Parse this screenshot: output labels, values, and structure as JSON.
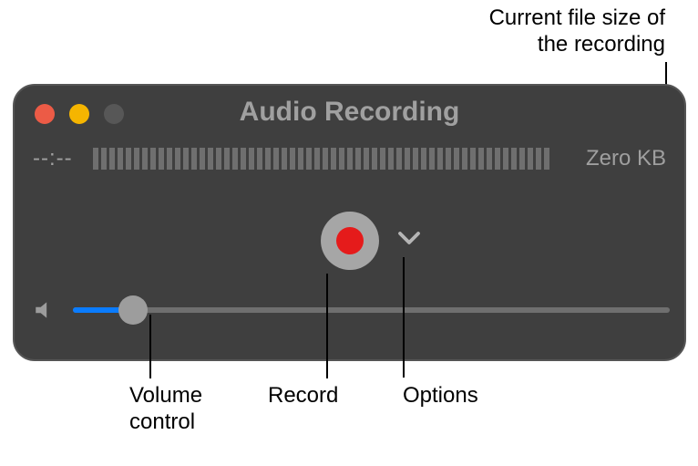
{
  "annotations": {
    "filesize": "Current file size of\nthe recording",
    "volume": "Volume\ncontrol",
    "record": "Record",
    "options": "Options"
  },
  "window": {
    "title": "Audio Recording",
    "time_elapsed": "--:--",
    "file_size": "Zero KB",
    "meter_segments": 56,
    "volume_percent": 10
  },
  "colors": {
    "window_bg": "#3f3f3f",
    "accent": "#0a7cff",
    "record_red": "#e51b1b"
  }
}
